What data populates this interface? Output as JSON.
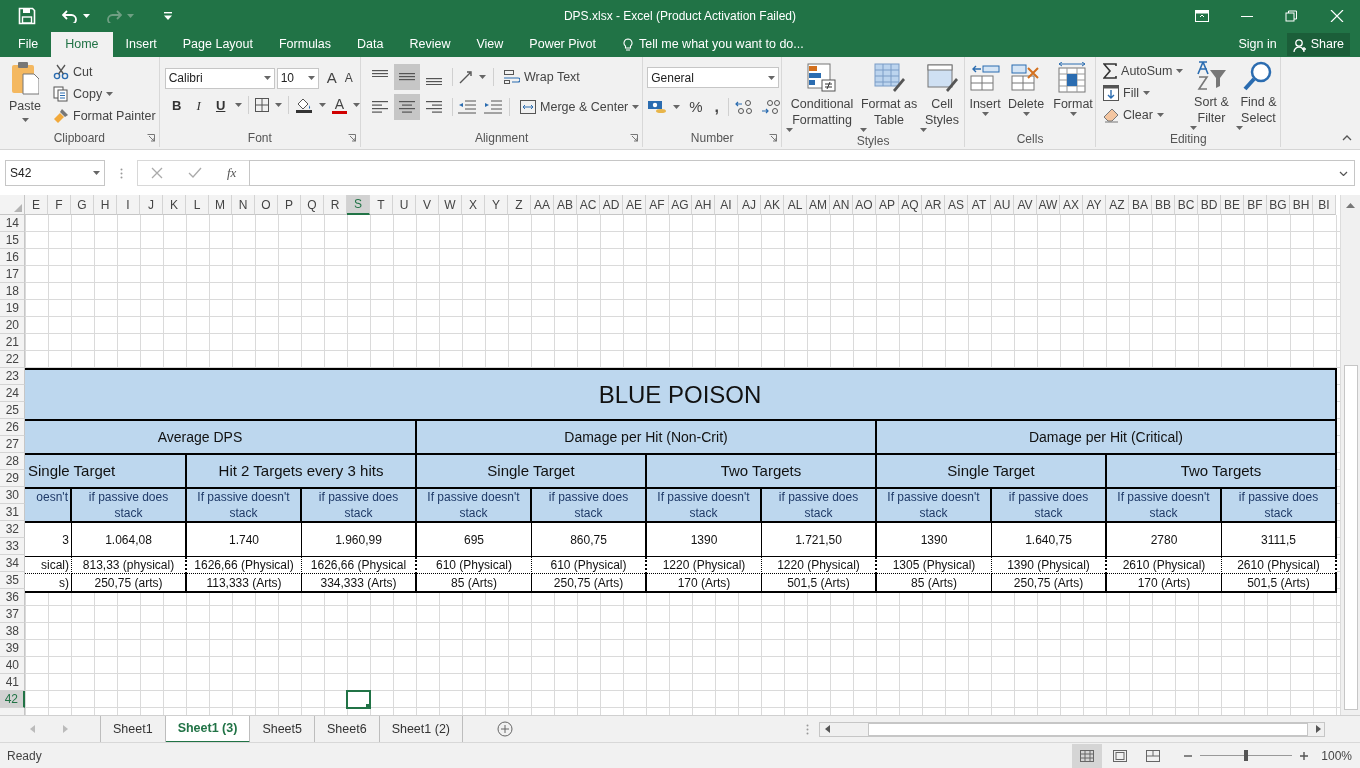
{
  "window": {
    "title": "DPS.xlsx - Excel (Product Activation Failed)"
  },
  "quick_access": {
    "redo_disabled": true
  },
  "ribbon_tabs": [
    {
      "label": "File",
      "selected": false
    },
    {
      "label": "Home",
      "selected": true
    },
    {
      "label": "Insert",
      "selected": false
    },
    {
      "label": "Page Layout",
      "selected": false
    },
    {
      "label": "Formulas",
      "selected": false
    },
    {
      "label": "Data",
      "selected": false
    },
    {
      "label": "Review",
      "selected": false
    },
    {
      "label": "View",
      "selected": false
    },
    {
      "label": "Power Pivot",
      "selected": false
    }
  ],
  "tell_me": {
    "placeholder": "Tell me what you want to do..."
  },
  "account": {
    "sign_in": "Sign in",
    "share": "Share"
  },
  "clipboard": {
    "paste": "Paste",
    "cut": "Cut",
    "copy": "Copy",
    "format_painter": "Format Painter",
    "label": "Clipboard"
  },
  "font": {
    "family": "Calibri",
    "size": "10",
    "grow": "A",
    "shrink": "A",
    "bold": "B",
    "italic": "I",
    "underline": "U",
    "font_color": "A",
    "label": "Font"
  },
  "alignment": {
    "vertical": [
      {
        "selected": false
      },
      {
        "selected": true
      },
      {
        "selected": false
      }
    ],
    "horizontal": [
      {
        "selected": false
      },
      {
        "selected": true
      },
      {
        "selected": false
      }
    ],
    "wrap_text": "Wrap Text",
    "merge_center": "Merge & Center",
    "label": "Alignment"
  },
  "number": {
    "format": "General",
    "percent": "%",
    "comma": ",",
    "label": "Number"
  },
  "styles": {
    "buttons": [
      "Conditional Formatting",
      "Format as Table",
      "Cell Styles"
    ],
    "label": "Styles"
  },
  "cells": {
    "buttons": [
      "Insert",
      "Delete",
      "Format"
    ],
    "label": "Cells"
  },
  "editing": {
    "autosum": "AutoSum",
    "fill": "Fill",
    "clear": "Clear",
    "sort_filter": "Sort & Filter",
    "find_select": "Find & Select",
    "label": "Editing"
  },
  "formula_bar": {
    "name_box": "S42",
    "fx": "fx"
  },
  "columns": [
    {
      "label": "E",
      "selected": false
    },
    {
      "label": "F",
      "selected": false
    },
    {
      "label": "G",
      "selected": false
    },
    {
      "label": "H",
      "selected": false
    },
    {
      "label": "I",
      "selected": false
    },
    {
      "label": "J",
      "selected": false
    },
    {
      "label": "K",
      "selected": false
    },
    {
      "label": "L",
      "selected": false
    },
    {
      "label": "M",
      "selected": false
    },
    {
      "label": "N",
      "selected": false
    },
    {
      "label": "O",
      "selected": false
    },
    {
      "label": "P",
      "selected": false
    },
    {
      "label": "Q",
      "selected": false
    },
    {
      "label": "R",
      "selected": false
    },
    {
      "label": "S",
      "selected": true
    },
    {
      "label": "T",
      "selected": false
    },
    {
      "label": "U",
      "selected": false
    },
    {
      "label": "V",
      "selected": false
    },
    {
      "label": "W",
      "selected": false
    },
    {
      "label": "X",
      "selected": false
    },
    {
      "label": "Y",
      "selected": false
    },
    {
      "label": "Z",
      "selected": false
    },
    {
      "label": "AA",
      "selected": false
    },
    {
      "label": "AB",
      "selected": false
    },
    {
      "label": "AC",
      "selected": false
    },
    {
      "label": "AD",
      "selected": false
    },
    {
      "label": "AE",
      "selected": false
    },
    {
      "label": "AF",
      "selected": false
    },
    {
      "label": "AG",
      "selected": false
    },
    {
      "label": "AH",
      "selected": false
    },
    {
      "label": "AI",
      "selected": false
    },
    {
      "label": "AJ",
      "selected": false
    },
    {
      "label": "AK",
      "selected": false
    },
    {
      "label": "AL",
      "selected": false
    },
    {
      "label": "AM",
      "selected": false
    },
    {
      "label": "AN",
      "selected": false
    },
    {
      "label": "AO",
      "selected": false
    },
    {
      "label": "AP",
      "selected": false
    },
    {
      "label": "AQ",
      "selected": false
    },
    {
      "label": "AR",
      "selected": false
    },
    {
      "label": "AS",
      "selected": false
    },
    {
      "label": "AT",
      "selected": false
    },
    {
      "label": "AU",
      "selected": false
    },
    {
      "label": "AV",
      "selected": false
    },
    {
      "label": "AW",
      "selected": false
    },
    {
      "label": "AX",
      "selected": false
    },
    {
      "label": "AY",
      "selected": false
    },
    {
      "label": "AZ",
      "selected": false
    },
    {
      "label": "BA",
      "selected": false
    },
    {
      "label": "BB",
      "selected": false
    },
    {
      "label": "BC",
      "selected": false
    },
    {
      "label": "BD",
      "selected": false
    },
    {
      "label": "BE",
      "selected": false
    },
    {
      "label": "BF",
      "selected": false
    },
    {
      "label": "BG",
      "selected": false
    },
    {
      "label": "BH",
      "selected": false
    },
    {
      "label": "BI",
      "selected": false
    }
  ],
  "rows": [
    {
      "label": "14",
      "selected": false
    },
    {
      "label": "15",
      "selected": false
    },
    {
      "label": "16",
      "selected": false
    },
    {
      "label": "17",
      "selected": false
    },
    {
      "label": "18",
      "selected": false
    },
    {
      "label": "19",
      "selected": false
    },
    {
      "label": "20",
      "selected": false
    },
    {
      "label": "21",
      "selected": false
    },
    {
      "label": "22",
      "selected": false
    },
    {
      "label": "23",
      "selected": false
    },
    {
      "label": "24",
      "selected": false
    },
    {
      "label": "25",
      "selected": false
    },
    {
      "label": "26",
      "selected": false
    },
    {
      "label": "27",
      "selected": false
    },
    {
      "label": "28",
      "selected": false
    },
    {
      "label": "29",
      "selected": false
    },
    {
      "label": "30",
      "selected": false
    },
    {
      "label": "31",
      "selected": false
    },
    {
      "label": "32",
      "selected": false
    },
    {
      "label": "33",
      "selected": false
    },
    {
      "label": "34",
      "selected": false
    },
    {
      "label": "35",
      "selected": false
    },
    {
      "label": "36",
      "selected": false
    },
    {
      "label": "37",
      "selected": false
    },
    {
      "label": "38",
      "selected": false
    },
    {
      "label": "39",
      "selected": false
    },
    {
      "label": "40",
      "selected": false
    },
    {
      "label": "41",
      "selected": false
    },
    {
      "label": "42",
      "selected": true
    }
  ],
  "table": {
    "title": "BLUE POISON",
    "groups": [
      "Average DPS",
      "Damage per Hit (Non-Crit)",
      "Damage per Hit (Critical)"
    ],
    "subgroups": [
      "Single Target",
      "Hit 2 Targets every 3 hits",
      "Single Target",
      "Two Targets",
      "Single Target",
      "Two Targets"
    ],
    "conditions": [
      "oesn't",
      "if passive does stack",
      "If passive doesn't stack",
      "if passive does stack",
      "If passive doesn't stack",
      "if passive does stack",
      "If passive doesn't stack",
      "if passive does stack",
      "If passive doesn't stack",
      "if passive does stack",
      "If passive doesn't stack",
      "if passive does stack"
    ],
    "totals": [
      "3",
      "1.064,08",
      "1.740",
      "1.960,99",
      "695",
      "860,75",
      "1390",
      "1.721,50",
      "1390",
      "1.640,75",
      "2780",
      "3111,5"
    ],
    "physical": [
      "sical)",
      "813,33 (physical)",
      "1626,66 (Physical)",
      "1626,66 (Physical",
      "610 (Physical)",
      "610 (Physical)",
      "1220 (Physical)",
      "1220 (Physical)",
      "1305 (Physical)",
      "1390 (Physical)",
      "2610 (Physical)",
      "2610 (Physical)"
    ],
    "arts": [
      "s)",
      "250,75 (arts)",
      "113,333 (Arts)",
      "334,333 (Arts)",
      "85 (Arts)",
      "250,75 (Arts)",
      "170 (Arts)",
      "501,5 (Arts)",
      "85 (Arts)",
      "250,75 (Arts)",
      "170 (Arts)",
      "501,5 (Arts)"
    ]
  },
  "sheet_tabs": [
    {
      "label": "Sheet1",
      "selected": false
    },
    {
      "label": "Sheet1 (3)",
      "selected": true
    },
    {
      "label": "Sheet5",
      "selected": false
    },
    {
      "label": "Sheet6",
      "selected": false
    },
    {
      "label": "Sheet1 (2)",
      "selected": false
    }
  ],
  "status_bar": {
    "status": "Ready",
    "views": [
      {
        "selected": true
      },
      {
        "selected": false
      },
      {
        "selected": false
      }
    ],
    "zoom_slider": {
      "level": 0.5
    },
    "zoom": "100%"
  }
}
